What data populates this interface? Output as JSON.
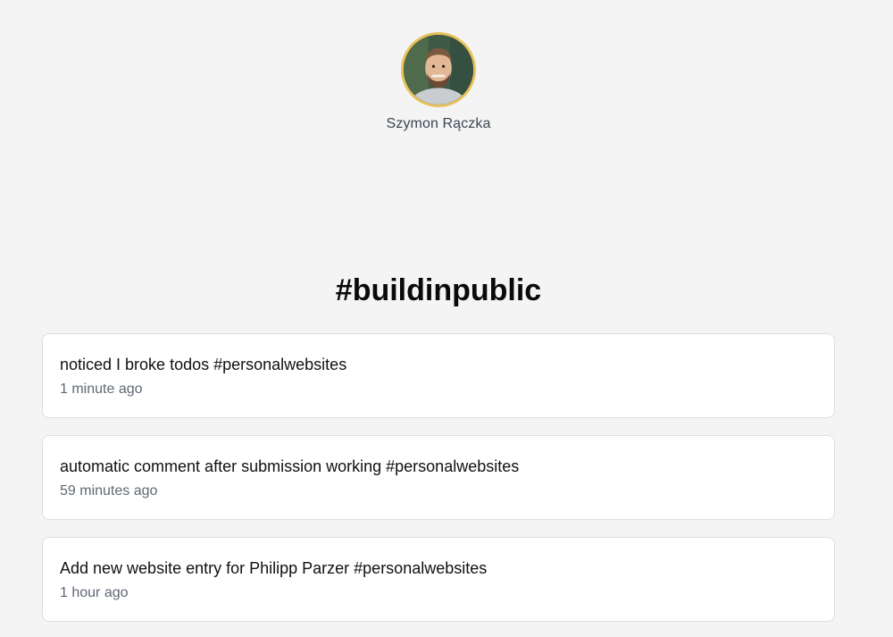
{
  "profile": {
    "name": "Szymon Rączka",
    "avatar_border_color": "#e8c15a"
  },
  "feed": {
    "title": "#buildinpublic",
    "posts": [
      {
        "text": "noticed I broke todos #personalwebsites",
        "time": "1 minute ago"
      },
      {
        "text": "automatic comment after submission working #personalwebsites",
        "time": "59 minutes ago"
      },
      {
        "text": "Add new website entry for Philipp Parzer #personalwebsites",
        "time": "1 hour ago"
      }
    ]
  }
}
